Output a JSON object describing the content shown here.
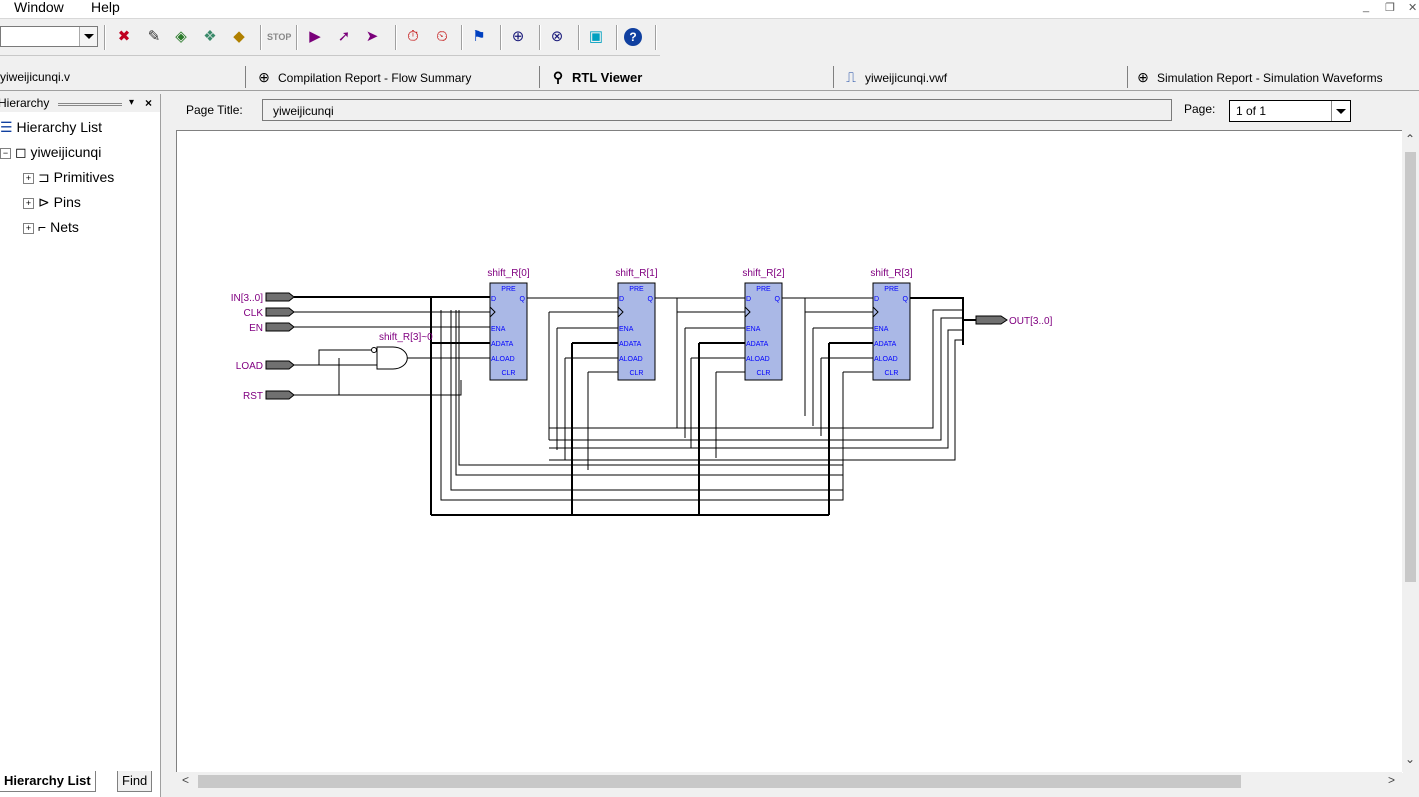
{
  "menu": {
    "window": "Window",
    "help": "Help"
  },
  "toolbar": {
    "icons": [
      "assignment-editor-icon",
      "pin-planner-icon",
      "settings-icon",
      "design-partitions-icon",
      "chip-planner-icon",
      "compile-icon",
      "stop-icon",
      "start-compilation-icon",
      "analysis-icon",
      "start-analysis-icon",
      "timing-analyzer-icon",
      "timequest-icon",
      "fitter-icon",
      "assembler-icon",
      "simulator-icon",
      "programmer-icon",
      "help-icon"
    ]
  },
  "tabs": [
    {
      "label": "yiweijicunqi.v",
      "active": false
    },
    {
      "label": "Compilation Report - Flow Summary",
      "active": false
    },
    {
      "label": "RTL Viewer",
      "active": true
    },
    {
      "label": "yiweijicunqi.vwf",
      "active": false
    },
    {
      "label": "Simulation Report - Simulation Waveforms",
      "active": false
    }
  ],
  "left_panel": {
    "title": "Hierarchy",
    "tree": {
      "root": "Hierarchy List",
      "design": "yiweijicunqi",
      "children": [
        "Primitives",
        "Pins",
        "Nets"
      ]
    },
    "bottom_tabs": [
      "Hierarchy List",
      "Find"
    ]
  },
  "page": {
    "title_label": "Page Title:",
    "title_value": "yiweijicunqi",
    "page_label": "Page:",
    "page_value": "1 of 1"
  },
  "schematic": {
    "inputs": [
      "IN[3..0]",
      "CLK",
      "EN",
      "LOAD",
      "RST"
    ],
    "output": "OUT[3..0]",
    "gate_label": "shift_R[3]~0",
    "registers": [
      "shift_R[0]",
      "shift_R[1]",
      "shift_R[2]",
      "shift_R[3]"
    ],
    "ports": [
      "PRE",
      "D",
      "Q",
      "ENA",
      "ADATA",
      "ALOAD",
      "CLR"
    ],
    "colors": {
      "label": "#800080",
      "port": "#0000ff",
      "reg_fill": "#aab8e6",
      "wire": "#000000"
    }
  }
}
